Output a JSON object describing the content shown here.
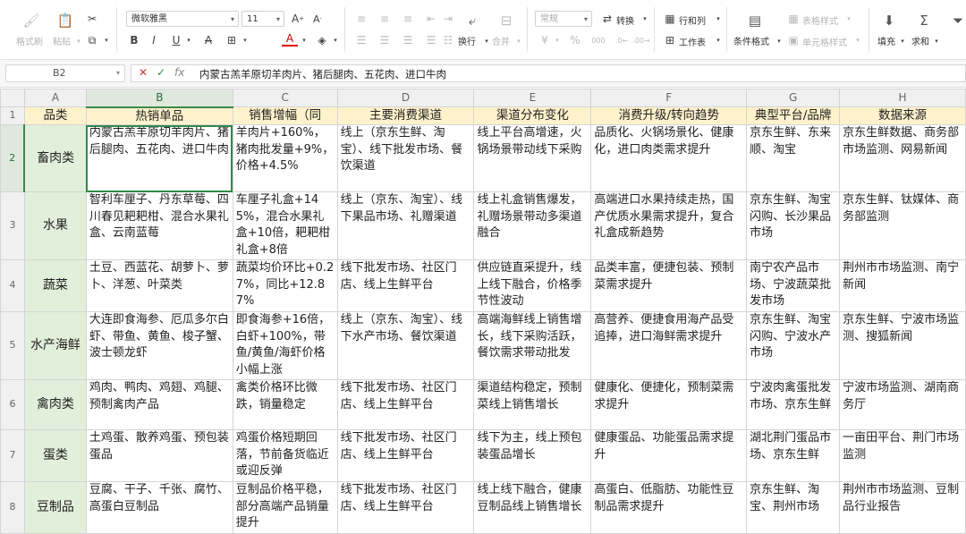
{
  "ribbon": {
    "format_painter": "格式刷",
    "paste": "粘贴",
    "font_name": "微软雅黑",
    "font_size": "11",
    "alignment_preset": "常规",
    "convert": "转换",
    "rows_cols": "行和列",
    "worksheet": "工作表",
    "conditional_format": "条件格式",
    "table_style": "表格样式",
    "cell_style": "单元格样式",
    "fill": "填充",
    "sum": "求和",
    "wrap": "换行",
    "merge": "合并",
    "percent": "%",
    "thousands": "000"
  },
  "formula_bar": {
    "cell_ref": "B2",
    "fx": "fx",
    "content": "内蒙古羔羊原切羊肉片、猪后腿肉、五花肉、进口牛肉"
  },
  "sheet": {
    "columns": [
      "A",
      "B",
      "C",
      "D",
      "E",
      "F",
      "G",
      "H"
    ],
    "headers": [
      "品类",
      "热销单品",
      "销售增幅（同",
      "主要消费渠道",
      "渠道分布变化",
      "消费升级/转向趋势",
      "典型平台/品牌",
      "数据来源"
    ],
    "rows": [
      {
        "num": "2",
        "cells": [
          "畜肉类",
          "内蒙古羔羊原切羊肉片、猪后腿肉、五花肉、进口牛肉",
          "羊肉片+160%，猪肉批发量+9%，价格+4.5%",
          "线上（京东生鲜、淘宝）、线下批发市场、餐饮渠道",
          "线上平台高增速，火锅场景带动线下采购",
          "品质化、火锅场景化、健康化，进口肉类需求提升",
          "京东生鲜、东来顺、淘宝",
          "京东生鲜数据、商务部市场监测、网易新闻"
        ]
      },
      {
        "num": "3",
        "cells": [
          "水果",
          "智利车厘子、丹东草莓、四川春见耙耙柑、混合水果礼盒、云南蓝莓",
          "车厘子礼盒+145%，混合水果礼盒+10倍，耙耙柑礼盒+8倍",
          "线上（京东、淘宝）、线下果品市场、礼赠渠道",
          "线上礼盒销售爆发，礼赠场景带动多渠道融合",
          "高端进口水果持续走热，国产优质水果需求提升，复合礼盒成新趋势",
          "京东生鲜、淘宝闪购、长沙果品市场",
          "京东生鲜、钛媒体、商务部监测"
        ]
      },
      {
        "num": "4",
        "cells": [
          "蔬菜",
          "土豆、西蓝花、胡萝卜、萝卜、洋葱、叶菜类",
          "蔬菜均价环比+0.27%，同比+12.87%",
          "线下批发市场、社区门店、线上生鲜平台",
          "供应链直采提升，线上线下融合，价格季节性波动",
          "品类丰富，便捷包装、预制菜需求提升",
          "南宁农产品市场、宁波蔬菜批发市场",
          "荆州市市场监测、南宁新闻"
        ]
      },
      {
        "num": "5",
        "cells": [
          "水产海鲜",
          "大连即食海参、厄瓜多尔白虾、带鱼、黄鱼、梭子蟹、波士顿龙虾",
          "即食海参+16倍，白虾+100%，带鱼/黄鱼/海虾价格小幅上涨",
          "线上（京东、淘宝）、线下水产市场、餐饮渠道",
          "高端海鲜线上销售增长，线下采购活跃，餐饮需求带动批发",
          "高营养、便捷食用海产品受追捧，进口海鲜需求提升",
          "京东生鲜、淘宝闪购、宁波水产市场",
          "京东生鲜、宁波市场监测、搜狐新闻"
        ]
      },
      {
        "num": "6",
        "cells": [
          "禽肉类",
          "鸡肉、鸭肉、鸡翅、鸡腿、预制禽肉产品",
          "禽类价格环比微跌，销量稳定",
          "线下批发市场、社区门店、线上生鲜平台",
          "渠道结构稳定，预制菜线上销售增长",
          "健康化、便捷化，预制菜需求提升",
          "宁波肉禽蛋批发市场、京东生鲜",
          "宁波市场监测、湖南商务厅"
        ]
      },
      {
        "num": "7",
        "cells": [
          "蛋类",
          "土鸡蛋、散养鸡蛋、预包装蛋品",
          "鸡蛋价格短期回落，节前备货临近或迎反弹",
          "线下批发市场、社区门店、线上生鲜平台",
          "线下为主，线上预包装蛋品增长",
          "健康蛋品、功能蛋品需求提升",
          "湖北荆门蛋品市场、京东生鲜",
          "一亩田平台、荆门市场监测"
        ]
      },
      {
        "num": "8",
        "cells": [
          "豆制品",
          "豆腐、干子、千张、腐竹、高蛋白豆制品",
          "豆制品价格平稳，部分高端产品销量提升",
          "线下批发市场、社区门店、线上生鲜平台",
          "线上线下融合，健康豆制品线上销售增长",
          "高蛋白、低脂肪、功能性豆制品需求提升",
          "京东生鲜、淘宝、荆州市场",
          "荆州市市场监测、豆制品行业报告"
        ]
      }
    ]
  }
}
